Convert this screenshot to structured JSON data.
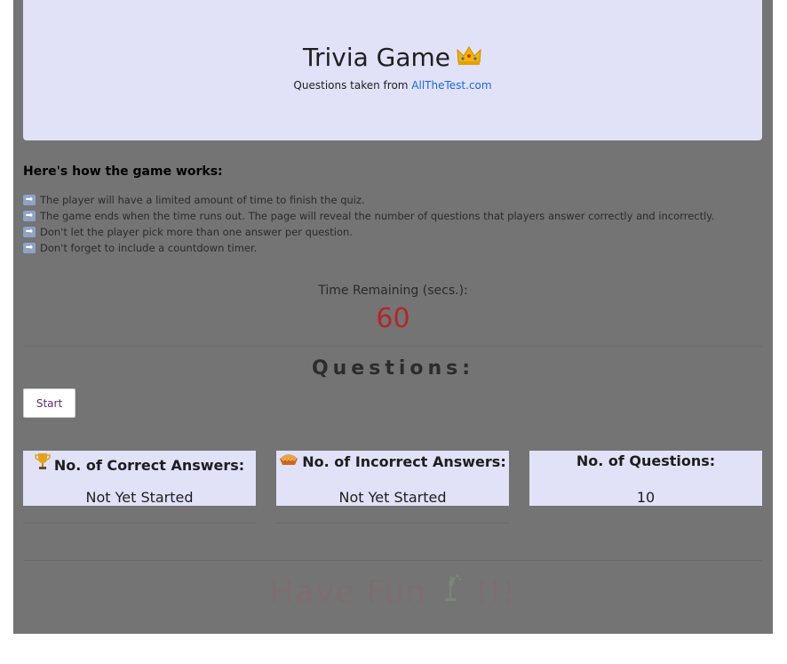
{
  "header": {
    "title": "Trivia Game",
    "title_icon": "crown-icon",
    "subtitle_prefix": "Questions taken from ",
    "subtitle_link": "AllTheTest.com"
  },
  "instructions": {
    "heading": "Here's how the game works:",
    "rules": [
      "The player will have a limited amount of time to finish the quiz.",
      "The game ends when the time runs out. The page will reveal the number of questions that players answer correctly and incorrectly.",
      "Don't let the player pick more than one answer per question.",
      "Don't forget to include a countdown timer."
    ]
  },
  "timer": {
    "label": "Time Remaining (secs.):",
    "value": "60"
  },
  "questions": {
    "title": "Questions:",
    "start_label": "Start"
  },
  "stats": [
    {
      "icon": "trophy-icon",
      "title": "No. of Correct Answers:",
      "value": "Not Yet Started"
    },
    {
      "icon": "pie-icon",
      "title": "No. of Incorrect Answers:",
      "value": "Not Yet Started"
    },
    {
      "icon": "",
      "title": "No. of Questions:",
      "value": "10"
    }
  ],
  "footer": {
    "text_a": "Have Fun",
    "text_b": "!!!",
    "icon": "champagne-icon"
  },
  "colors": {
    "background": "#747474",
    "card": "#e1e1f8",
    "timer": "#b3262b",
    "link": "#1b6ad6"
  }
}
